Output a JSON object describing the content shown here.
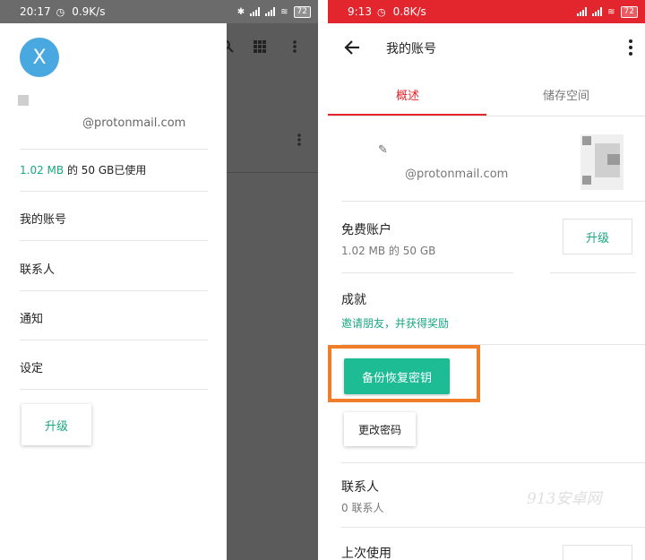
{
  "left_phone": {
    "status": {
      "time": "20:17",
      "speed": "0.9K/s",
      "battery": "72"
    },
    "drawer": {
      "avatar_letter": "X",
      "email": "@protonmail.com",
      "usage_value": "1.02 MB",
      "usage_rest": " 的 50 GB已使用",
      "items": [
        {
          "label": "我的账号"
        },
        {
          "label": "联系人"
        },
        {
          "label": "通知"
        },
        {
          "label": "设定"
        }
      ],
      "upgrade_label": "升级"
    }
  },
  "right_phone": {
    "status": {
      "time": "9:13",
      "speed": "0.8K/s",
      "battery": "72"
    },
    "appbar": {
      "title": "我的账号"
    },
    "tabs": [
      {
        "label": "概述"
      },
      {
        "label": "储存空间"
      }
    ],
    "account": {
      "email": "@protonmail.com"
    },
    "plan": {
      "label": "免费账户",
      "usage": "1.02 MB 的 50 GB",
      "upgrade_label": "升级"
    },
    "achievements": {
      "label": "成就",
      "link": "邀请朋友，并获得奖励"
    },
    "backup_button": "备份恢复密钥",
    "change_password_button": "更改密码",
    "contacts": {
      "label": "联系人",
      "count": "0 联系人"
    },
    "last_used": {
      "label": "上次使用"
    },
    "watermark": "913安卓网"
  },
  "colors": {
    "accent_green": "#1aa682",
    "button_green": "#1dbc95",
    "brand_red": "#e3262d",
    "highlight_orange": "#ef7d2a",
    "avatar_blue": "#4aa8e0"
  }
}
